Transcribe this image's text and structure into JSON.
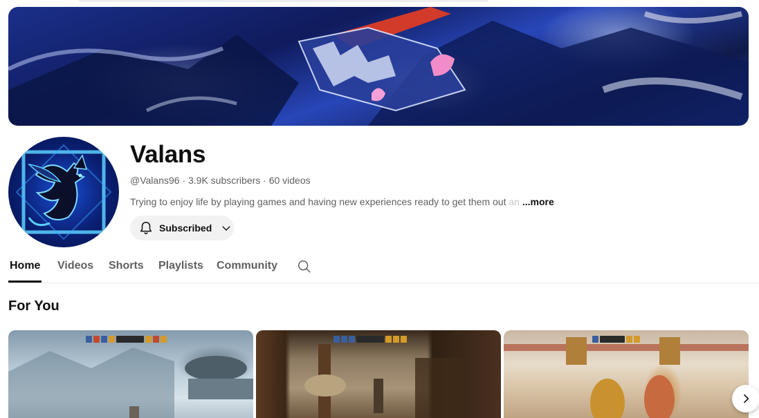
{
  "channel": {
    "name": "Valans",
    "meta": "@Valans96 · 3.9K subscribers · 60 videos",
    "description": "Trying to enjoy life by playing games and having new experiences ready to get them out ",
    "description_fade": "an",
    "more_label": "...more"
  },
  "subscribe": {
    "label": "Subscribed",
    "icon": "bell-icon",
    "dropdown_icon": "chevron-down-icon"
  },
  "tabs": [
    {
      "label": "Home",
      "active": true
    },
    {
      "label": "Videos",
      "active": false
    },
    {
      "label": "Shorts",
      "active": false
    },
    {
      "label": "Playlists",
      "active": false
    },
    {
      "label": "Community",
      "active": false
    }
  ],
  "tab_search_icon": "search-icon",
  "section": {
    "title": "For You",
    "next_icon": "chevron-right-icon"
  },
  "colors": {
    "text_primary": "#0f0f0f",
    "text_secondary": "#606060",
    "button_bg": "#f2f2f2",
    "divider": "#e5e5e5"
  }
}
